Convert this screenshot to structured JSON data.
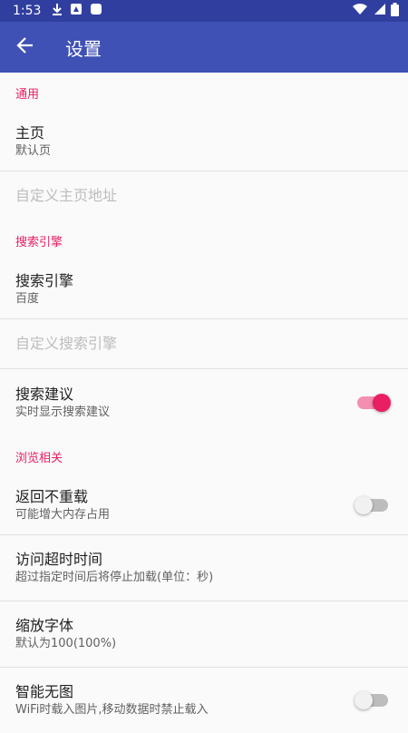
{
  "status_bar": {
    "time": "1:53"
  },
  "toolbar": {
    "title": "设置"
  },
  "sections": {
    "general": {
      "header": "通用",
      "home_title": "主页",
      "home_summary": "默认页",
      "custom_home": "自定义主页地址"
    },
    "search": {
      "header": "搜索引擎",
      "engine_title": "搜索引擎",
      "engine_summary": "百度",
      "custom_engine": "自定义搜索引擎",
      "suggest_title": "搜索建议",
      "suggest_summary": "实时显示搜索建议",
      "suggest_enabled": true
    },
    "browsing": {
      "header": "浏览相关",
      "no_reload_title": "返回不重载",
      "no_reload_summary": "可能增大内存占用",
      "no_reload_enabled": false,
      "timeout_title": "访问超时时间",
      "timeout_summary": "超过指定时间后将停止加载(单位：秒)",
      "font_title": "缩放字体",
      "font_summary": "默认为100(100%)",
      "no_image_title": "智能无图",
      "no_image_summary": "WiFi时载入图片,移动数据时禁止载入",
      "no_image_enabled": false
    }
  },
  "colors": {
    "primary": "#3f51b5",
    "primary_dark": "#303f9f",
    "accent": "#e91e63"
  }
}
